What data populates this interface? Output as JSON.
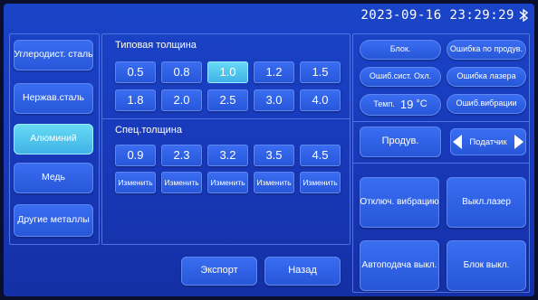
{
  "header": {
    "datetime": "2023-09-16 23:29:29",
    "bluetooth_icon": "bluetooth-icon"
  },
  "materials": [
    "Углеродист. сталь",
    "Нержав.сталь",
    "Алюминий",
    "Медь",
    "Другие металлы"
  ],
  "selected_material": "Алюминий",
  "typical_thickness": {
    "title": "Типовая толщина",
    "values": [
      "0.5",
      "0.8",
      "1.0",
      "1.2",
      "1.5",
      "1.8",
      "2.0",
      "2.5",
      "3.0",
      "4.0"
    ],
    "selected": "1.0"
  },
  "special_thickness": {
    "title": "Спец.толщина",
    "values": [
      "0.9",
      "2.3",
      "3.2",
      "3.5",
      "4.5"
    ],
    "edit_label": "Изменить"
  },
  "bottom_buttons": {
    "export": "Экспорт",
    "back": "Назад"
  },
  "status": {
    "block": "Блок.",
    "purge_error": "Ошибка по продув.",
    "cooling_error": "Ошиб.сист. Охл.",
    "laser_error": "Ошибка лазера",
    "temp_label": "Темп.",
    "temp_value": "19",
    "temp_unit": "°C",
    "vibration_error": "Ошиб.вибрации"
  },
  "controls": {
    "purge": "Продув.",
    "feeder": "Податчик",
    "vibration_off": "Отключ. вибрацию",
    "laser_off": "Выкл.лазер",
    "autofeed_off": "Автоподача выкл.",
    "block_off": "Блок выкл."
  },
  "colors": {
    "background": "#1a44c8",
    "button": "#2f62e6",
    "active": "#4fc6ee",
    "border": "#4f72e3"
  }
}
